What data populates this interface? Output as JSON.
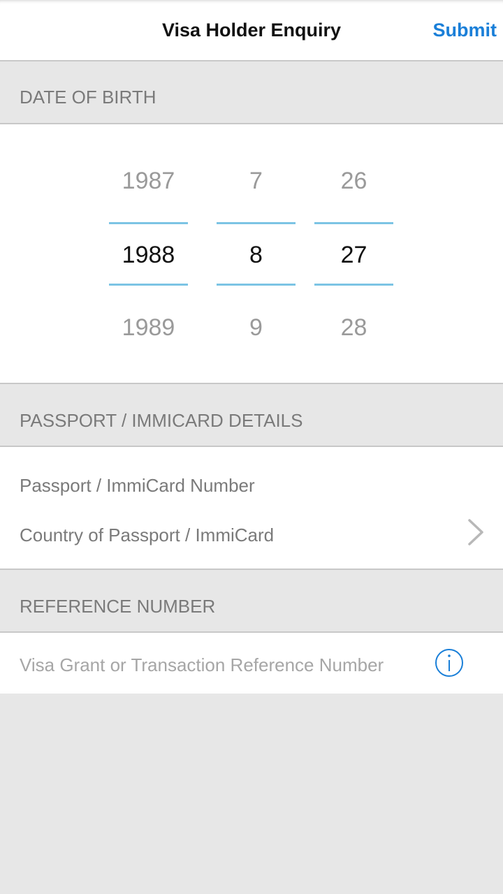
{
  "header": {
    "title": "Visa Holder Enquiry",
    "submit_label": "Submit"
  },
  "sections": {
    "dob": {
      "label": "DATE OF BIRTH"
    },
    "passport": {
      "label": "PASSPORT / IMMICARD DETAILS"
    },
    "reference": {
      "label": "REFERENCE NUMBER"
    }
  },
  "date_picker": {
    "year": {
      "prev": "1987",
      "selected": "1988",
      "next": "1989"
    },
    "month": {
      "prev": "7",
      "selected": "8",
      "next": "9"
    },
    "day": {
      "prev": "26",
      "selected": "27",
      "next": "28"
    }
  },
  "passport_fields": {
    "number_placeholder": "Passport / ImmiCard Number",
    "country_label": "Country of Passport / ImmiCard"
  },
  "reference_field": {
    "placeholder": "Visa Grant or Transaction Reference Number"
  },
  "icons": {
    "chevron": "chevron-right-icon",
    "info": "info-icon"
  },
  "colors": {
    "accent": "#1a7fd8",
    "picker_line": "#7cc4e4",
    "section_bg": "#e7e7e7"
  }
}
